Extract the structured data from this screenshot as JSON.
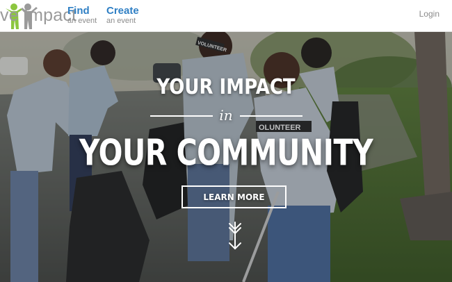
{
  "header": {
    "logo_text": "ve Impact",
    "nav": [
      {
        "label": "Find",
        "sub": "an event"
      },
      {
        "label": "Create",
        "sub": "an event"
      }
    ],
    "login_label": "Login"
  },
  "hero": {
    "headline_top": "YOUR IMPACT",
    "headline_mid": "in",
    "headline_bottom": "YOUR COMMUNITY",
    "cta_label": "LEARN MORE",
    "shirt_text_1": "VOLUNTEER",
    "shirt_text_2": "OLUNTEER"
  },
  "icons": {
    "logo_figures": "people-icon",
    "scroll_down": "down-arrow-icon"
  },
  "colors": {
    "nav_link": "#2f7fc4",
    "logo_green": "#8cc63f",
    "logo_gray": "#9a9a9a",
    "hero_text": "#ffffff"
  }
}
